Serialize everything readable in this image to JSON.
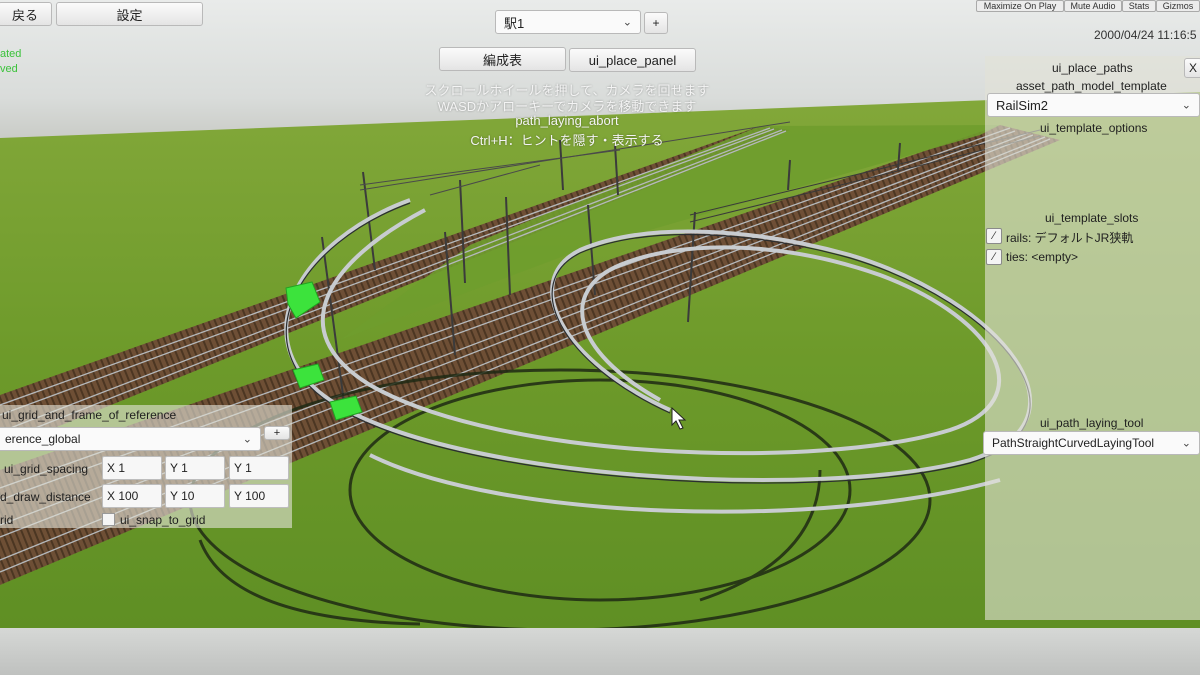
{
  "toolbar": {
    "back_label": "戻る",
    "settings_label": "設定",
    "station_select_value": "駅1",
    "add_label": "+",
    "datetime": "2000/04/24 11:16:5",
    "formation_label": "編成表",
    "place_panel_label": "ui_place_panel"
  },
  "editor_bar": {
    "maximize_label": "Maximize On Play",
    "mute_label": "Mute Audio",
    "stats_label": "Stats",
    "gizmos_label": "Gizmos"
  },
  "status_left": {
    "line1": "ated",
    "line2": "ved"
  },
  "hints": {
    "line1": "スクロールホイールを押して、カメラを回せます",
    "line2": "WASDかアローキーでカメラを移動できます",
    "line3": "path_laying_abort",
    "line4": "Ctrl+H：ヒントを隠す・表示する"
  },
  "right_panel": {
    "close_label": "X",
    "title": "ui_place_paths",
    "template_label": "asset_path_model_template",
    "template_value": "RailSim2",
    "options_label": "ui_template_options",
    "slots_label": "ui_template_slots",
    "slots": [
      {
        "label": "rails: デフォルトJR狭軌"
      },
      {
        "label": "ties: <empty>"
      }
    ],
    "tool_label": "ui_path_laying_tool",
    "tool_value": "PathStraightCurvedLayingTool"
  },
  "left_panel": {
    "title": "ui_grid_and_frame_of_reference",
    "frame_value": "erence_global",
    "add_label": "+",
    "grid_spacing_label": "ui_grid_spacing",
    "grid_spacing": {
      "x": "X 1",
      "y": "Y 1",
      "z": "Y 1"
    },
    "draw_distance_label": "d_draw_distance",
    "draw_distance": {
      "x": "X 100",
      "y": "Y 10",
      "z": "Y 100"
    },
    "grid_label": "rid",
    "snap_label": "ui_snap_to_grid"
  },
  "colors": {
    "grass": "#6f9a2c",
    "ballast": "#6b4a35",
    "rail": "#aeb3b7",
    "marker_green": "#39e23a",
    "hint_text": "#f4f4f4"
  }
}
